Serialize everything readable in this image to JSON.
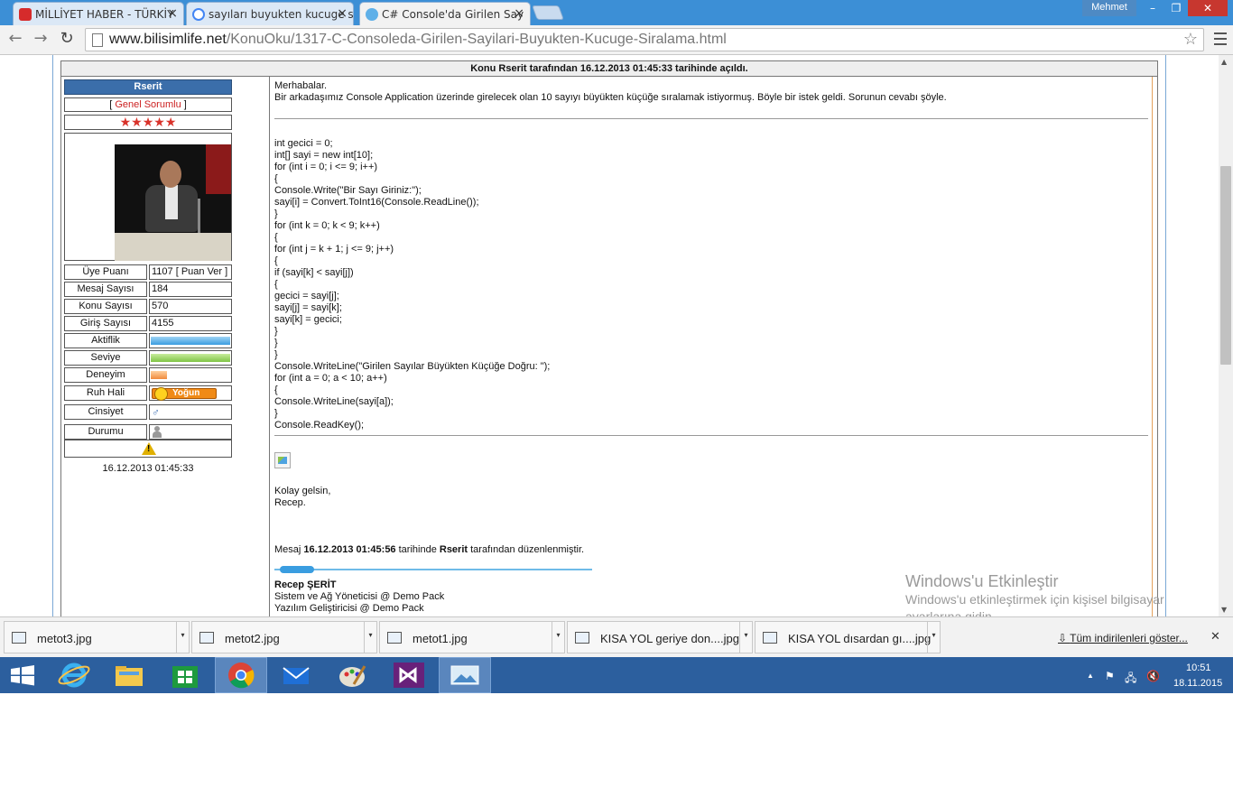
{
  "browser": {
    "tabs": [
      {
        "title": "MİLLİYET HABER - TÜRKİY",
        "close": "×"
      },
      {
        "title": "sayıları buyukten kucuge s",
        "close": "×"
      },
      {
        "title": "C# Console'da Girilen Say",
        "close": "×"
      }
    ],
    "profile_name": "Mehmet",
    "window_controls": {
      "minimize": "–",
      "maximize": "❐",
      "close": "✕"
    },
    "url_host": "www.bilisimlife.net",
    "url_path": "/KonuOku/1317-C-Consoleda-Girilen-Sayilari-Buyukten-Kucuge-Siralama.html",
    "nav": {
      "back": "←",
      "forward": "→",
      "reload": "↻",
      "star": "☆"
    }
  },
  "topic_header": "Konu Rserit tarafından 16.12.2013 01:45:33 tarihinde açıldı.",
  "user": {
    "name": "Rserit",
    "role_open": "[ ",
    "role": "Genel Sorumlu",
    "role_close": " ]",
    "stars": "★★★★★",
    "stats": [
      {
        "label": "Üye Puanı",
        "value": "1107 [ Puan Ver ]"
      },
      {
        "label": "Mesaj Sayısı",
        "value": "184"
      },
      {
        "label": "Konu Sayısı",
        "value": "570"
      },
      {
        "label": "Giriş Sayısı",
        "value": "4155"
      }
    ],
    "bars": [
      {
        "label": "Aktiflik",
        "fill": 1.0
      },
      {
        "label": "Seviye",
        "fill": 1.0
      },
      {
        "label": "Deneyim",
        "fill": 0.2
      }
    ],
    "mood_label": "Ruh Hali",
    "mood_value": "Yoğun",
    "gender_label": "Cinsiyet",
    "gender_icon": "♂",
    "status_label": "Durumu",
    "warning_mark": "!",
    "post_date": "16.12.2013 01:45:33"
  },
  "post": {
    "greeting": "Merhabalar.",
    "intro": "Bir arkadaşımız Console Application üzerinde girelecek olan 10 sayıyı büyükten küçüğe sıralamak istiyormuş. Böyle bir istek geldi. Sorunun cevabı şöyle.",
    "code": [
      "int gecici = 0;",
      "int[] sayi = new int[10];",
      "for (int i = 0; i <= 9; i++)",
      "{",
      "Console.Write(\"Bir Sayı Giriniz:\");",
      "sayi[i] = Convert.ToInt16(Console.ReadLine());",
      "}",
      "for (int k = 0; k < 9; k++)",
      "{",
      "for (int j = k + 1; j <= 9; j++)",
      "{",
      "if (sayi[k] < sayi[j])",
      "{",
      "gecici = sayi[j];",
      "sayi[j] = sayi[k];",
      "sayi[k] = gecici;",
      "}",
      "}",
      "}",
      "Console.WriteLine(\"Girilen Sayılar Büyükten Küçüğe Doğru: \");",
      "for (int a = 0; a < 10; a++)",
      "{",
      "Console.WriteLine(sayi[a]);",
      "}",
      "Console.ReadKey();"
    ],
    "closing1": "Kolay gelsin,",
    "closing2": "Recep.",
    "edited_prefix": "Mesaj ",
    "edited_date": "16.12.2013 01:45:56",
    "edited_mid": " tarihinde ",
    "edited_user": "Rserit",
    "edited_suffix": " tarafından düzenlenmiştir.",
    "sig_name": "Recep ŞERİT",
    "sig_line1": "Sistem ve Ağ Yöneticisi @ Demo Pack",
    "sig_line2": "Yazılım Geliştiricisi @ Demo Pack"
  },
  "watermark": {
    "title": "Windows'u Etkinleştir",
    "line1": "Windows'u etkinleştirmek için kişisel bilgisayar",
    "line2": "ayarlarına gidin."
  },
  "downloads": {
    "items": [
      "metot3.jpg",
      "metot2.jpg",
      "metot1.jpg",
      "KISA YOL geriye don....jpg",
      "KISA YOL dısardan gı....jpg"
    ],
    "dropdown": "▾",
    "show_all": "Tüm indirilenleri göster...",
    "close": "✕"
  },
  "taskbar": {
    "time": "10:51",
    "date": "18.11.2015",
    "tray_up": "▲",
    "tray_flag": "⚑",
    "tray_net": "🖧",
    "tray_sound": "🔇"
  },
  "colors": {
    "accent_blue": "#3b6eaa",
    "role_red": "#cc2222",
    "taskbar": "#2c5f9e",
    "tab_strip": "#3c8fd6"
  }
}
